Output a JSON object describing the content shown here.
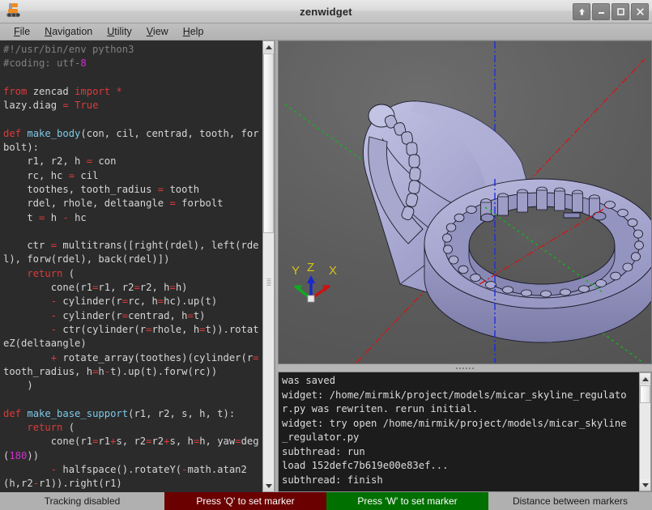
{
  "window": {
    "title": "zenwidget",
    "icon": "robot-crawler-icon",
    "buttons": [
      {
        "name": "shade-button",
        "glyph": "↑"
      },
      {
        "name": "minimize-button",
        "glyph": "–"
      },
      {
        "name": "maximize-button",
        "glyph": "□"
      },
      {
        "name": "close-button",
        "glyph": "✕"
      }
    ]
  },
  "menubar": {
    "items": [
      {
        "mnemonic": "F",
        "rest": "ile"
      },
      {
        "mnemonic": "N",
        "rest": "avigation"
      },
      {
        "mnemonic": "U",
        "rest": "tility"
      },
      {
        "mnemonic": "V",
        "rest": "iew"
      },
      {
        "mnemonic": "H",
        "rest": "elp"
      }
    ]
  },
  "editor": {
    "language": "python",
    "lines": [
      "#!/usr/bin/env python3",
      "#coding: utf-8",
      "",
      "from zencad import *",
      "lazy.diag = True",
      "",
      "def make_body(con, cil, centrad, tooth, forbolt):",
      "    r1, r2, h = con",
      "    rc, hc = cil",
      "    toothes, tooth_radius = tooth",
      "    rdel, rhole, deltaangle = forbolt",
      "    t = h - hc",
      "",
      "    ctr = multitrans([right(rdel), left(rdel), forw(rdel), back(rdel)])",
      "    return (",
      "        cone(r1=r1, r2=r2, h=h)",
      "        - cylinder(r=rc, h=hc).up(t)",
      "        - cylinder(r=centrad, h=t)",
      "        - ctr(cylinder(r=rhole, h=t)).rotateZ(deltaangle)",
      "        + rotate_array(toothes)(cylinder(r=tooth_radius, h=h-t).up(t).forw(rc))",
      "    )",
      "",
      "def make_base_support(r1, r2, s, h, t):",
      "    return (",
      "        cone(r1=r1+s, r2=r2+s, h=h, yaw=deg(180))",
      "        - halfspace().rotateY(-math.atan2(h,r2-r1)).right(r1)"
    ]
  },
  "console": {
    "lines": [
      "was saved",
      "widget: /home/mirmik/project/models/micar_skyline_regulator.py was rewriten. rerun initial.",
      "widget: try open /home/mirmik/project/models/micar_skyline_regulator.py",
      "subthread: run",
      "load 152defc7b619e00e83ef...",
      "subthread: finish"
    ]
  },
  "viewport": {
    "axis_gizmo": {
      "x_label": "X",
      "y_label": "Y",
      "z_label": "Z",
      "x_color": "#cc1111",
      "y_color": "#11aa22",
      "z_color": "#1a27cc",
      "label_color": "#d8c317"
    },
    "axes_lines": {
      "x_color": "#d01818",
      "y_color": "#13b518",
      "z_color": "#1f2fd8"
    },
    "model_color": "#a0a0d0",
    "background_color": "#5c5c5c"
  },
  "statusbar": {
    "tracking": "Tracking disabled",
    "q_marker": "Press 'Q' to set marker",
    "w_marker": "Press 'W' to set marker",
    "distance": "Distance between markers",
    "q_color": "#6b0000",
    "w_color": "#007000"
  }
}
